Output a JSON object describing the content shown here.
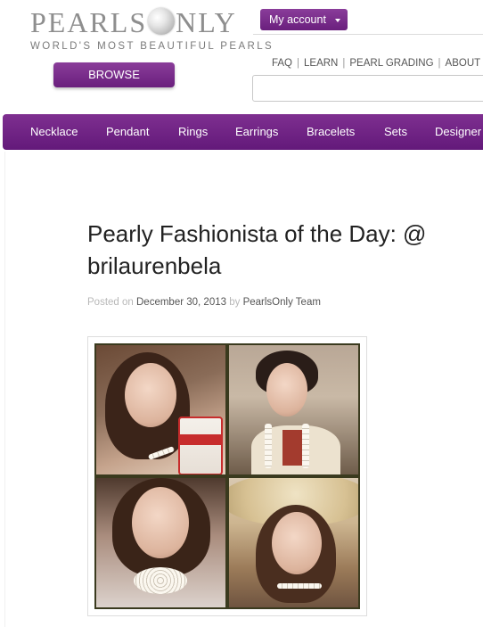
{
  "header": {
    "logo": {
      "text_left": "PEARLS",
      "text_right": "NLY",
      "tagline": "WORLD'S MOST BEAUTIFUL PEARLS"
    },
    "browse_label": "BROWSE",
    "account_label": "My account",
    "top_links": [
      "FAQ",
      "LEARN",
      "PEARL GRADING",
      "ABOUT US"
    ],
    "search": {
      "value": "",
      "placeholder": ""
    }
  },
  "nav": {
    "items": [
      "Necklace",
      "Pendant",
      "Rings",
      "Earrings",
      "Bracelets",
      "Sets",
      "Designer"
    ]
  },
  "post": {
    "title": "Pearly Fashionista of the Day: @ brilaurenbela",
    "posted_prefix": "Posted on",
    "date": "December 30, 2013",
    "by_prefix": "by",
    "author": "PearlsOnly Team"
  },
  "colors": {
    "brand_purple": "#6a1f7d",
    "nav_purple": "#7e2f90",
    "text": "#222222"
  }
}
